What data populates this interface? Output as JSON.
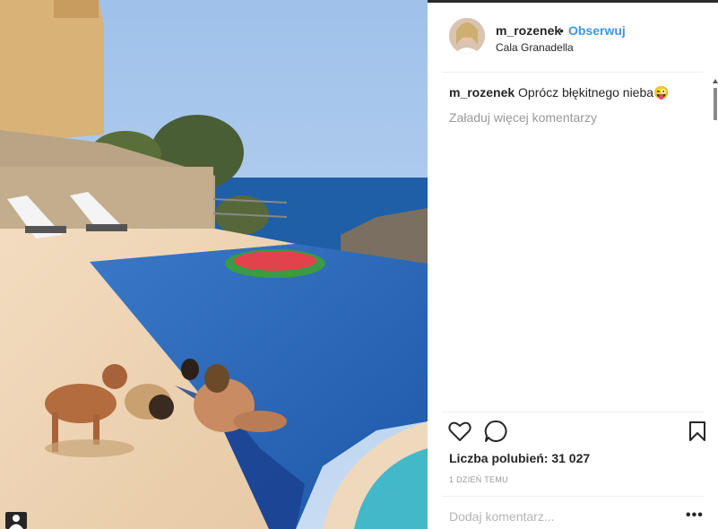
{
  "post": {
    "username": "m_rozenek",
    "separator": "•",
    "follow_label": "Obserwuj",
    "location": "Cala Granadella",
    "caption_user": "m_rozenek",
    "caption_text": "Oprócz błękitnego nieba😜",
    "load_more_label": "Załaduj więcej komentarzy",
    "likes_label": "Liczba polubień: 31 027",
    "time_label": "1 DZIEŃ TEMU",
    "comment_placeholder": "Dodaj komentarz...",
    "more_label": "•••"
  },
  "colors": {
    "accent": "#3897f0",
    "text": "#262626",
    "muted": "#999999",
    "pool": "#2f6fbf",
    "sky": "#a9c8eb",
    "sea": "#1f5fa8"
  },
  "icons": {
    "like": "heart-icon",
    "comment": "comment-bubble-icon",
    "save": "bookmark-icon",
    "user_tag": "user-tag-icon"
  }
}
